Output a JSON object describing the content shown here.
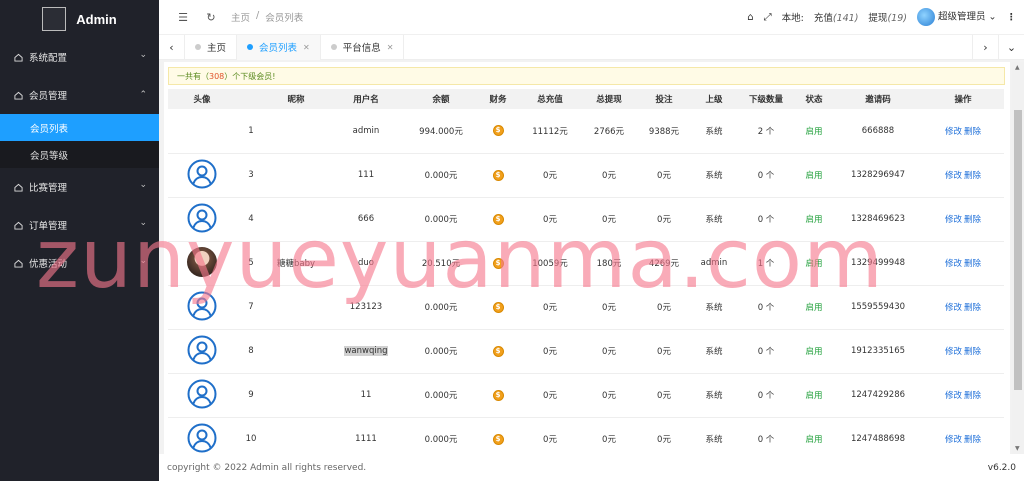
{
  "sidebar": {
    "logo_text": "Admin",
    "menu": [
      {
        "label": "系统配置",
        "icon": "home-icon"
      },
      {
        "label": "会员管理",
        "icon": "home-icon",
        "expanded": true
      },
      {
        "label": "比赛管理",
        "icon": "home-icon"
      },
      {
        "label": "订单管理",
        "icon": "home-icon"
      },
      {
        "label": "优惠活动",
        "icon": "home-icon"
      }
    ],
    "sub_items": [
      {
        "label": "会员列表",
        "active": true
      },
      {
        "label": "会员等级"
      }
    ]
  },
  "header": {
    "breadcrumb": [
      "主页",
      "/",
      "会员列表"
    ],
    "local_label": "本地:",
    "recharge_label": "充值",
    "recharge_count": "(141)",
    "withdraw_label": "提现",
    "withdraw_count": "(19)",
    "user_name": "超级管理员"
  },
  "tabs": [
    {
      "label": "主页"
    },
    {
      "label": "会员列表",
      "active": true
    },
    {
      "label": "平台信息"
    }
  ],
  "notice": {
    "prefix": "一共有（",
    "count": "308",
    "suffix": "）个下级会员!"
  },
  "table": {
    "headers": [
      "头像",
      "",
      "昵称",
      "用户名",
      "余额",
      "财务",
      "总充值",
      "总提现",
      "投注",
      "上级",
      "下级数量",
      "状态",
      "邀请码",
      "操作"
    ],
    "edit_label": "修改",
    "delete_label": "删除",
    "coin_symbol": "$",
    "rows": [
      {
        "avatar": "none",
        "id": "1",
        "nickname": "",
        "username": "admin",
        "balance": "994.000元",
        "recharge": "11112元",
        "withdraw": "2766元",
        "bet": "9388元",
        "parent": "系统",
        "children": "2 个",
        "status": "启用",
        "invite": "666888"
      },
      {
        "avatar": "icon",
        "id": "3",
        "nickname": "",
        "username": "111",
        "balance": "0.000元",
        "recharge": "0元",
        "withdraw": "0元",
        "bet": "0元",
        "parent": "系统",
        "children": "0 个",
        "status": "启用",
        "invite": "1328296947"
      },
      {
        "avatar": "icon",
        "id": "4",
        "nickname": "",
        "username": "666",
        "balance": "0.000元",
        "recharge": "0元",
        "withdraw": "0元",
        "bet": "0元",
        "parent": "系统",
        "children": "0 个",
        "status": "启用",
        "invite": "1328469623"
      },
      {
        "avatar": "photo",
        "id": "5",
        "nickname": "糖糖baby",
        "username": "duo",
        "balance": "20.510元",
        "recharge": "10059元",
        "withdraw": "180元",
        "bet": "4269元",
        "parent": "admin",
        "children": "1 个",
        "status": "启用",
        "invite": "1329499948"
      },
      {
        "avatar": "icon",
        "id": "7",
        "nickname": "",
        "username": "123123",
        "balance": "0.000元",
        "recharge": "0元",
        "withdraw": "0元",
        "bet": "0元",
        "parent": "系统",
        "children": "0 个",
        "status": "启用",
        "invite": "1559559430"
      },
      {
        "avatar": "icon",
        "id": "8",
        "nickname": "",
        "username": "wanwqing",
        "balance": "0.000元",
        "recharge": "0元",
        "withdraw": "0元",
        "bet": "0元",
        "parent": "系统",
        "children": "0 个",
        "status": "启用",
        "invite": "1912335165",
        "highlight": true
      },
      {
        "avatar": "icon",
        "id": "9",
        "nickname": "",
        "username": "11",
        "balance": "0.000元",
        "recharge": "0元",
        "withdraw": "0元",
        "bet": "0元",
        "parent": "系统",
        "children": "0 个",
        "status": "启用",
        "invite": "1247429286"
      },
      {
        "avatar": "icon",
        "id": "10",
        "nickname": "",
        "username": "1111",
        "balance": "0.000元",
        "recharge": "0元",
        "withdraw": "0元",
        "bet": "0元",
        "parent": "系统",
        "children": "0 个",
        "status": "启用",
        "invite": "1247488698"
      }
    ]
  },
  "footer": {
    "copyright": "copyright © 2022 Admin all rights reserved.",
    "version": "v6.2.0"
  },
  "watermark": "zunyueyuanma.com",
  "colors": {
    "sidebar": "#20222a",
    "accent": "#1e9fff",
    "status": "#21a03b",
    "link": "#1e6fd9",
    "watermark": "#f5788c"
  }
}
